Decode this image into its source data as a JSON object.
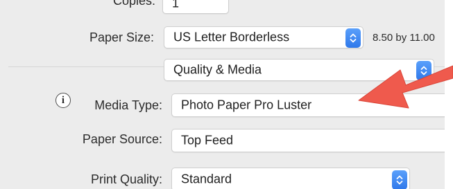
{
  "copies": {
    "label": "Copies:",
    "value": "1"
  },
  "paper_size": {
    "label": "Paper Size:",
    "value": "US Letter Borderless",
    "dimensions_text": "8.50 by 11.00"
  },
  "panel_menu": {
    "value": "Quality & Media"
  },
  "media_type": {
    "label": "Media Type:",
    "value": "Photo Paper Pro Luster",
    "info_icon_glyph": "i"
  },
  "paper_source": {
    "label": "Paper Source:",
    "value": "Top Feed"
  },
  "print_quality": {
    "label": "Print Quality:",
    "value": "Standard"
  },
  "colors": {
    "stepper_blue": "#3a86f0",
    "annotation_arrow": "#ef5a4d"
  }
}
